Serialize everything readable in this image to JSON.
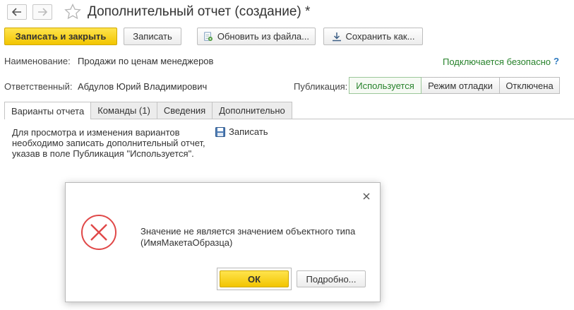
{
  "header": {
    "title": "Дополнительный отчет (создание) *"
  },
  "toolbar": {
    "save_close_label": "Записать и закрыть",
    "save_label": "Записать",
    "update_from_file_label": "Обновить из файла...",
    "save_as_label": "Сохранить как..."
  },
  "form": {
    "name_label": "Наименование:",
    "name_value": "Продажи по ценам менеджеров",
    "secure_link": "Подключается безопасно",
    "help_mark": "?",
    "responsible_label": "Ответственный:",
    "responsible_value": "Абдулов Юрий Владимирович",
    "publication_label": "Публикация:",
    "publication_options": [
      "Используется",
      "Режим отладки",
      "Отключена"
    ]
  },
  "tabs": [
    "Варианты отчета",
    "Команды (1)",
    "Сведения",
    "Дополнительно"
  ],
  "variants_tab": {
    "note": "Для просмотра и изменения вариантов необходимо записать дополнительный отчет, указав в поле Публикация \"Используется\".",
    "save_link": "Записать"
  },
  "dialog": {
    "message_line1": "Значение не является значением объектного типа",
    "message_line2": "(ИмяМакетаОбразца)",
    "ok_label": "ОК",
    "details_label": "Подробно..."
  },
  "colors": {
    "accent_yellow": "#f2c500",
    "green": "#27822b",
    "error_red": "#e04848"
  }
}
